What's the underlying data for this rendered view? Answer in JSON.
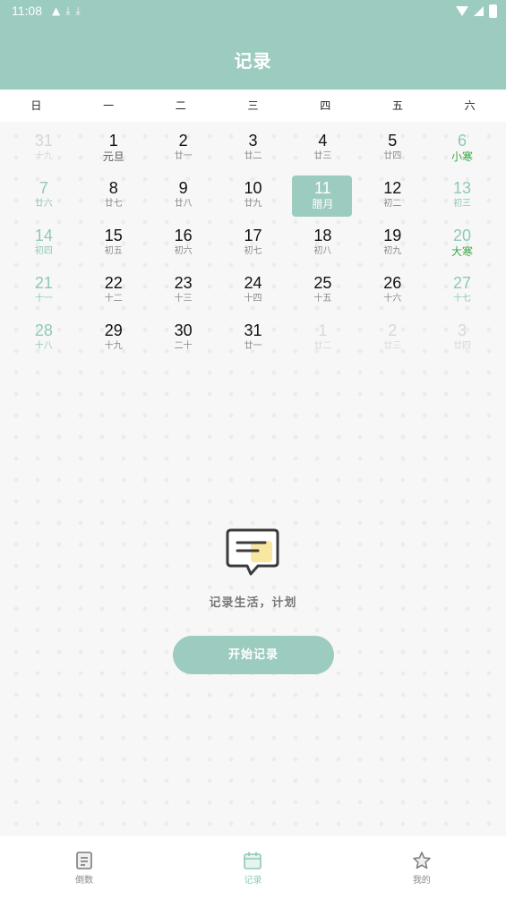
{
  "status_bar": {
    "time": "11:08"
  },
  "header": {
    "title": "记录"
  },
  "weekdays": [
    "日",
    "一",
    "二",
    "三",
    "四",
    "五",
    "六"
  ],
  "calendar": {
    "days": [
      {
        "day": "31",
        "lunar": "十九",
        "type": "dim"
      },
      {
        "day": "1",
        "lunar": "元旦",
        "type": "festival"
      },
      {
        "day": "2",
        "lunar": "廿一",
        "type": ""
      },
      {
        "day": "3",
        "lunar": "廿二",
        "type": ""
      },
      {
        "day": "4",
        "lunar": "廿三",
        "type": ""
      },
      {
        "day": "5",
        "lunar": "廿四",
        "type": ""
      },
      {
        "day": "6",
        "lunar": "小寒",
        "type": "weekend term"
      },
      {
        "day": "7",
        "lunar": "廿六",
        "type": "weekend"
      },
      {
        "day": "8",
        "lunar": "廿七",
        "type": ""
      },
      {
        "day": "9",
        "lunar": "廿八",
        "type": ""
      },
      {
        "day": "10",
        "lunar": "廿九",
        "type": ""
      },
      {
        "day": "11",
        "lunar": "腊月",
        "type": "selected"
      },
      {
        "day": "12",
        "lunar": "初二",
        "type": ""
      },
      {
        "day": "13",
        "lunar": "初三",
        "type": "weekend"
      },
      {
        "day": "14",
        "lunar": "初四",
        "type": "weekend"
      },
      {
        "day": "15",
        "lunar": "初五",
        "type": ""
      },
      {
        "day": "16",
        "lunar": "初六",
        "type": ""
      },
      {
        "day": "17",
        "lunar": "初七",
        "type": ""
      },
      {
        "day": "18",
        "lunar": "初八",
        "type": ""
      },
      {
        "day": "19",
        "lunar": "初九",
        "type": ""
      },
      {
        "day": "20",
        "lunar": "大寒",
        "type": "weekend term"
      },
      {
        "day": "21",
        "lunar": "十一",
        "type": "weekend"
      },
      {
        "day": "22",
        "lunar": "十二",
        "type": ""
      },
      {
        "day": "23",
        "lunar": "十三",
        "type": ""
      },
      {
        "day": "24",
        "lunar": "十四",
        "type": ""
      },
      {
        "day": "25",
        "lunar": "十五",
        "type": ""
      },
      {
        "day": "26",
        "lunar": "十六",
        "type": ""
      },
      {
        "day": "27",
        "lunar": "十七",
        "type": "weekend"
      },
      {
        "day": "28",
        "lunar": "十八",
        "type": "weekend"
      },
      {
        "day": "29",
        "lunar": "十九",
        "type": ""
      },
      {
        "day": "30",
        "lunar": "二十",
        "type": ""
      },
      {
        "day": "31",
        "lunar": "廿一",
        "type": ""
      },
      {
        "day": "1",
        "lunar": "廿二",
        "type": "fade"
      },
      {
        "day": "2",
        "lunar": "廿三",
        "type": "fade"
      },
      {
        "day": "3",
        "lunar": "廿四",
        "type": "fade"
      }
    ]
  },
  "empty_state": {
    "icon": "message-icon",
    "text": "记录生活，计划",
    "button_label": "开始记录"
  },
  "bottom_nav": [
    {
      "label": "倒数",
      "icon": "countdown-icon",
      "active": false
    },
    {
      "label": "记录",
      "icon": "calendar-icon",
      "active": true
    },
    {
      "label": "我的",
      "icon": "star-icon",
      "active": false
    }
  ],
  "colors": {
    "accent": "#9ccbbf",
    "term_green": "#3aa844"
  }
}
